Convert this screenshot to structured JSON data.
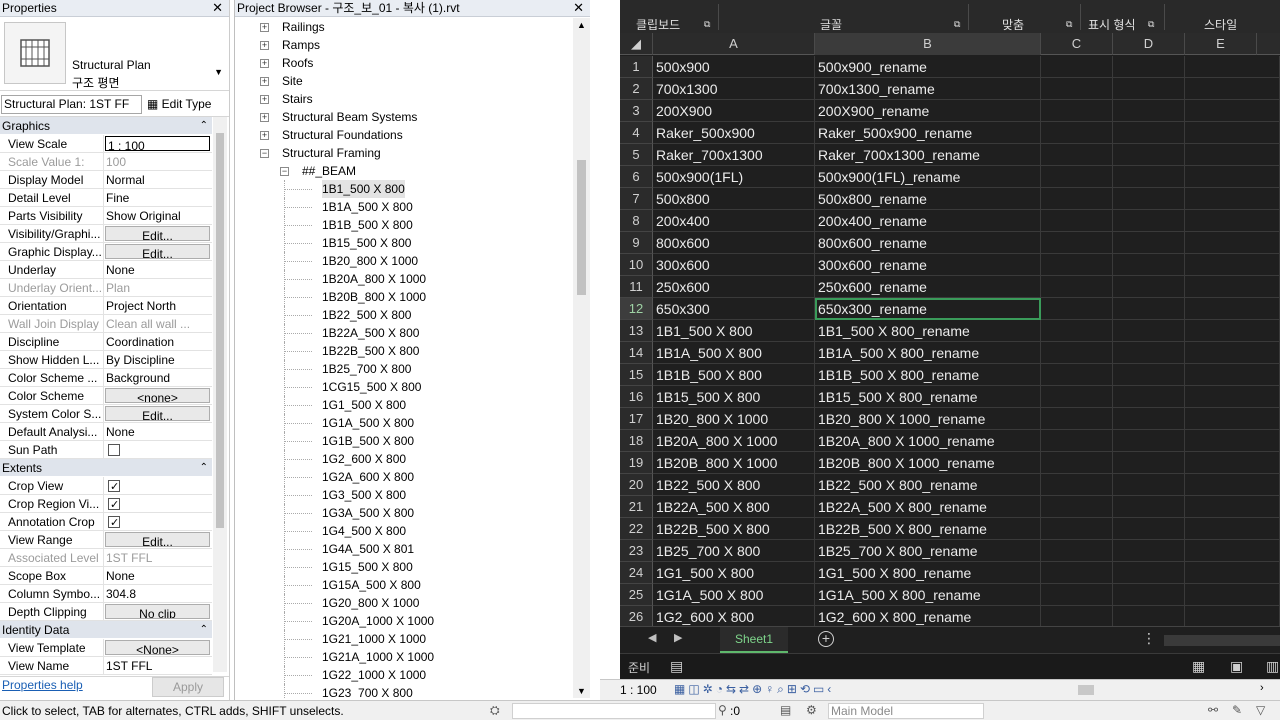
{
  "properties": {
    "title": "Properties",
    "type_name_1": "Structural Plan",
    "type_name_2": "구조 평면",
    "instance_selector": "Structural Plan: 1ST FF",
    "edit_type": "Edit Type",
    "groups": [
      {
        "name": "Graphics",
        "rows": [
          {
            "k": "View Scale",
            "v": "1 : 100",
            "kind": "box"
          },
          {
            "k": "Scale Value    1:",
            "v": "100",
            "kind": "dis"
          },
          {
            "k": "Display Model",
            "v": "Normal"
          },
          {
            "k": "Detail Level",
            "v": "Fine"
          },
          {
            "k": "Parts Visibility",
            "v": "Show Original"
          },
          {
            "k": "Visibility/Graphi...",
            "v": "Edit...",
            "kind": "btn"
          },
          {
            "k": "Graphic Display...",
            "v": "Edit...",
            "kind": "btn"
          },
          {
            "k": "Underlay",
            "v": "None"
          },
          {
            "k": "Underlay Orient...",
            "v": "Plan",
            "kind": "dis"
          },
          {
            "k": "Orientation",
            "v": "Project North"
          },
          {
            "k": "Wall Join Display",
            "v": "Clean all wall ...",
            "kind": "dis"
          },
          {
            "k": "Discipline",
            "v": "Coordination"
          },
          {
            "k": "Show Hidden L...",
            "v": "By Discipline"
          },
          {
            "k": "Color Scheme ...",
            "v": "Background"
          },
          {
            "k": "Color Scheme",
            "v": "<none>",
            "kind": "btn"
          },
          {
            "k": "System Color S...",
            "v": "Edit...",
            "kind": "btn"
          },
          {
            "k": "Default Analysi...",
            "v": "None"
          },
          {
            "k": "Sun Path",
            "v": "",
            "kind": "cb0"
          }
        ]
      },
      {
        "name": "Extents",
        "rows": [
          {
            "k": "Crop View",
            "v": "",
            "kind": "cb1"
          },
          {
            "k": "Crop Region Vi...",
            "v": "",
            "kind": "cb1"
          },
          {
            "k": "Annotation Crop",
            "v": "",
            "kind": "cb1"
          },
          {
            "k": "View Range",
            "v": "Edit...",
            "kind": "btn"
          },
          {
            "k": "Associated Level",
            "v": "1ST FFL",
            "kind": "dis"
          },
          {
            "k": "Scope Box",
            "v": "None"
          },
          {
            "k": "Column Symbo...",
            "v": "304.8"
          },
          {
            "k": "Depth Clipping",
            "v": "No clip",
            "kind": "btn"
          }
        ]
      },
      {
        "name": "Identity Data",
        "rows": [
          {
            "k": "View Template",
            "v": "<None>",
            "kind": "btn"
          },
          {
            "k": "View Name",
            "v": "1ST FFL"
          }
        ]
      }
    ],
    "help_link": "Properties help",
    "apply": "Apply"
  },
  "browser": {
    "title": "Project Browser - 구조_보_01 - 복사 (1).rvt",
    "nodes": [
      {
        "label": "Railings",
        "level": 1,
        "pm": "+"
      },
      {
        "label": "Ramps",
        "level": 1,
        "pm": "+"
      },
      {
        "label": "Roofs",
        "level": 1,
        "pm": "+"
      },
      {
        "label": "Site",
        "level": 1,
        "pm": "+"
      },
      {
        "label": "Stairs",
        "level": 1,
        "pm": "+"
      },
      {
        "label": "Structural Beam Systems",
        "level": 1,
        "pm": "+"
      },
      {
        "label": "Structural Foundations",
        "level": 1,
        "pm": "+"
      },
      {
        "label": "Structural Framing",
        "level": 1,
        "pm": "−"
      },
      {
        "label": "##_BEAM",
        "level": 2,
        "pm": "−"
      },
      {
        "label": "1B1_500 X 800",
        "level": 3,
        "hl": true
      },
      {
        "label": "1B1A_500 X 800",
        "level": 3
      },
      {
        "label": "1B1B_500 X 800",
        "level": 3
      },
      {
        "label": "1B15_500 X 800",
        "level": 3
      },
      {
        "label": "1B20_800 X 1000",
        "level": 3
      },
      {
        "label": "1B20A_800 X 1000",
        "level": 3
      },
      {
        "label": "1B20B_800 X 1000",
        "level": 3
      },
      {
        "label": "1B22_500 X 800",
        "level": 3
      },
      {
        "label": "1B22A_500 X 800",
        "level": 3
      },
      {
        "label": "1B22B_500 X 800",
        "level": 3
      },
      {
        "label": "1B25_700 X 800",
        "level": 3
      },
      {
        "label": "1CG15_500 X 800",
        "level": 3
      },
      {
        "label": "1G1_500 X 800",
        "level": 3
      },
      {
        "label": "1G1A_500 X 800",
        "level": 3
      },
      {
        "label": "1G1B_500 X 800",
        "level": 3
      },
      {
        "label": "1G2_600 X 800",
        "level": 3
      },
      {
        "label": "1G2A_600 X 800",
        "level": 3
      },
      {
        "label": "1G3_500 X 800",
        "level": 3
      },
      {
        "label": "1G3A_500 X 800",
        "level": 3
      },
      {
        "label": "1G4_500 X 800",
        "level": 3
      },
      {
        "label": "1G4A_500 X 801",
        "level": 3
      },
      {
        "label": "1G15_500 X 800",
        "level": 3
      },
      {
        "label": "1G15A_500 X 800",
        "level": 3
      },
      {
        "label": "1G20_800 X 1000",
        "level": 3
      },
      {
        "label": "1G20A_1000 X 1000",
        "level": 3
      },
      {
        "label": "1G21_1000 X 1000",
        "level": 3
      },
      {
        "label": "1G21A_1000 X 1000",
        "level": 3
      },
      {
        "label": "1G22_1000 X 1000",
        "level": 3
      },
      {
        "label": "1G23_700 X 800",
        "level": 3
      }
    ]
  },
  "excel": {
    "ribbon_groups": [
      "클립보드",
      "글꼴",
      "맞춤",
      "표시 형식",
      "스타일"
    ],
    "columns": [
      "A",
      "B",
      "C",
      "D",
      "E"
    ],
    "rows": [
      {
        "n": "1",
        "a": "500x900",
        "b": "500x900_rename"
      },
      {
        "n": "2",
        "a": "700x1300",
        "b": "700x1300_rename"
      },
      {
        "n": "3",
        "a": "200X900",
        "b": "200X900_rename"
      },
      {
        "n": "4",
        "a": "Raker_500x900",
        "b": "Raker_500x900_rename"
      },
      {
        "n": "5",
        "a": "Raker_700x1300",
        "b": "Raker_700x1300_rename"
      },
      {
        "n": "6",
        "a": "500x900(1FL)",
        "b": "500x900(1FL)_rename"
      },
      {
        "n": "7",
        "a": "500x800",
        "b": "500x800_rename"
      },
      {
        "n": "8",
        "a": "200x400",
        "b": "200x400_rename"
      },
      {
        "n": "9",
        "a": "800x600",
        "b": "800x600_rename"
      },
      {
        "n": "10",
        "a": "300x600",
        "b": "300x600_rename"
      },
      {
        "n": "11",
        "a": "250x600",
        "b": "250x600_rename"
      },
      {
        "n": "12",
        "a": "650x300",
        "b": "650x300_rename",
        "active": true
      },
      {
        "n": "13",
        "a": "1B1_500 X 800",
        "b": "1B1_500 X 800_rename"
      },
      {
        "n": "14",
        "a": "1B1A_500 X 800",
        "b": "1B1A_500 X 800_rename"
      },
      {
        "n": "15",
        "a": "1B1B_500 X 800",
        "b": "1B1B_500 X 800_rename"
      },
      {
        "n": "16",
        "a": "1B15_500 X 800",
        "b": "1B15_500 X 800_rename"
      },
      {
        "n": "17",
        "a": "1B20_800 X 1000",
        "b": "1B20_800 X 1000_rename"
      },
      {
        "n": "18",
        "a": "1B20A_800 X 1000",
        "b": "1B20A_800 X 1000_rename"
      },
      {
        "n": "19",
        "a": "1B20B_800 X 1000",
        "b": "1B20B_800 X 1000_rename"
      },
      {
        "n": "20",
        "a": "1B22_500 X 800",
        "b": "1B22_500 X 800_rename"
      },
      {
        "n": "21",
        "a": "1B22A_500 X 800",
        "b": "1B22A_500 X 800_rename"
      },
      {
        "n": "22",
        "a": "1B22B_500 X 800",
        "b": "1B22B_500 X 800_rename"
      },
      {
        "n": "23",
        "a": "1B25_700 X 800",
        "b": "1B25_700 X 800_rename"
      },
      {
        "n": "24",
        "a": "1G1_500 X 800",
        "b": "1G1_500 X 800_rename"
      },
      {
        "n": "25",
        "a": "1G1A_500 X 800",
        "b": "1G1A_500 X 800_rename"
      },
      {
        "n": "26",
        "a": "1G2_600 X 800",
        "b": "1G2_600 X 800_rename"
      }
    ],
    "sheet_tab": "Sheet1",
    "status_ready": "준비"
  },
  "viewbar": {
    "scale": "1 : 100"
  },
  "statusbar": {
    "message": "Click to select, TAB for alternates, CTRL adds, SHIFT unselects.",
    "zero": ":0",
    "model": "Main Model"
  },
  "colors": {
    "excel_bg": "#1f1f1f",
    "excel_accent": "#3a9b5a",
    "revit_panel_header": "#e9edf3",
    "revit_group": "#dfe4ec"
  }
}
